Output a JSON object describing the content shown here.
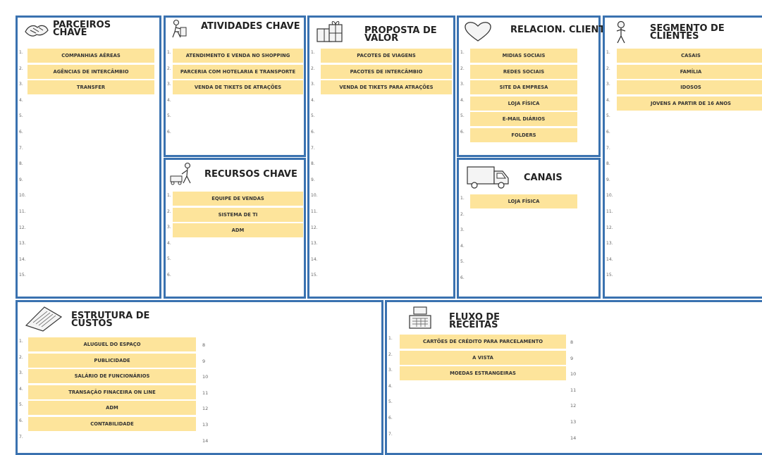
{
  "parceiros": {
    "title_line1": "PARCEIROS",
    "title_line2": "CHAVE",
    "items": [
      "COMPANHIAS AÉREAS",
      "AGÊNCIAS DE INTERCÂMBIO",
      "TRANSFER",
      "",
      "",
      "",
      "",
      "",
      "",
      "",
      "",
      "",
      "",
      "",
      ""
    ],
    "numbers": [
      "1.",
      "2.",
      "3.",
      "4.",
      "5.",
      "6.",
      "7.",
      "8.",
      "9.",
      "10.",
      "11.",
      "12.",
      "13.",
      "14.",
      "15."
    ]
  },
  "atividades": {
    "title": "ATIVIDADES CHAVE",
    "items": [
      "ATENDIMENTO E VENDA NO SHOPPING",
      "PARCERIA COM HOTELARIA E TRANSPORTE",
      "VENDA DE TIKETS  DE ATRAÇÕES",
      "",
      "",
      ""
    ],
    "numbers": [
      "1.",
      "2.",
      "3.",
      "4.",
      "5.",
      "6."
    ]
  },
  "recursos": {
    "title": "RECURSOS CHAVE",
    "items": [
      "EQUIPE DE VENDAS",
      "SISTEMA DE TI",
      "ADM",
      "",
      "",
      ""
    ],
    "numbers": [
      "1.",
      "2.",
      "3.",
      "4.",
      "5.",
      "6."
    ]
  },
  "proposta": {
    "title_line1": "PROPOSTA DE",
    "title_line2": "VALOR",
    "items": [
      "PACOTES DE VIAGENS",
      "PACOTES DE INTERCÂMBIO",
      "VENDA DE TIKETS PARA ATRAÇÕES",
      "",
      "",
      "",
      "",
      "",
      "",
      "",
      "",
      "",
      "",
      "",
      ""
    ],
    "numbers": [
      "1.",
      "2.",
      "3.",
      "4.",
      "5.",
      "6.",
      "7.",
      "8.",
      "9.",
      "10.",
      "11.",
      "12.",
      "13.",
      "14.",
      "15."
    ]
  },
  "relacion": {
    "title": "RELACION. CLIENTE",
    "items": [
      "MIDIAS SOCIAIS",
      "REDES SOCIAIS",
      "SITE DA EMPRESA",
      "LOJA FÍSICA",
      "E-MAIL DIÁRIOS",
      "FOLDERS"
    ],
    "numbers": [
      "1.",
      "2.",
      "3.",
      "4.",
      "5.",
      "6."
    ]
  },
  "canais": {
    "title": "CANAIS",
    "items": [
      "LOJA FÍSICA",
      "",
      "",
      "",
      "",
      ""
    ],
    "numbers": [
      "1.",
      "2.",
      "3.",
      "4.",
      "5.",
      "6."
    ]
  },
  "segmento": {
    "title_line1": "SEGMENTO DE",
    "title_line2": "CLIENTES",
    "items": [
      "CASAIS",
      "FAMÍLIA",
      "IDOSOS",
      "JOVENS A PARTIR DE 16 ANOS",
      "",
      "",
      "",
      "",
      "",
      "",
      "",
      "",
      "",
      "",
      ""
    ],
    "numbers": [
      "1.",
      "2.",
      "3.",
      "4.",
      "5.",
      "6.",
      "7.",
      "8.",
      "9.",
      "10.",
      "11.",
      "12.",
      "13.",
      "14.",
      "15."
    ]
  },
  "custos": {
    "title_line1": "ESTRUTURA DE",
    "title_line2": "CUSTOS",
    "items": [
      "ALUGUEL DO ESPAÇO",
      "PUBLICIDADE",
      "SALÁRIO DE FUNCIONÁRIOS",
      "TRANSAÇÃO FINACEIRA ON LINE",
      "ADM",
      "CONTABILIDADE",
      ""
    ],
    "numbers": [
      "1.",
      "2.",
      "3.",
      "4.",
      "5.",
      "6.",
      "7."
    ],
    "right_numbers": [
      "8",
      "9",
      "10",
      "11",
      "12",
      "13",
      "14"
    ]
  },
  "receitas": {
    "title_line1": "FLUXO DE",
    "title_line2": "RECEITAS",
    "items": [
      "CARTÕES DE CRÉDITO PARA PARCELAMENTO",
      "A VISTA",
      "MOEDAS ESTRANGEIRAS",
      "",
      "",
      "",
      ""
    ],
    "numbers": [
      "1.",
      "2.",
      "3.",
      "4.",
      "5.",
      "6.",
      "7."
    ],
    "right_numbers": [
      "8",
      "9",
      "10",
      "11",
      "12",
      "13",
      "14"
    ]
  },
  "colors": {
    "border": "#3a72b0",
    "cell": "#fde49b"
  }
}
